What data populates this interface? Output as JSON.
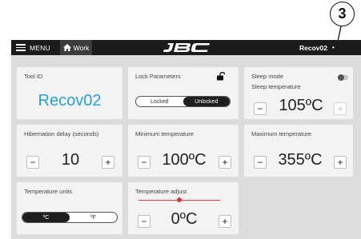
{
  "callout": {
    "number": "3"
  },
  "topbar": {
    "menu_label": "MENU",
    "work_label": "Work",
    "logo_text": "JBC",
    "device_name": "Recov02",
    "device_menu_glyph": "•"
  },
  "cards": {
    "tool_id": {
      "title": "Tool ID",
      "value": "Recov02"
    },
    "lock": {
      "title": "Lock Parameters",
      "options": [
        "Locked",
        "Unlocked"
      ],
      "selected": "Unlocked"
    },
    "sleep": {
      "title": "Sleep mode",
      "subtitle": "Sleep temperature",
      "value": "105ºC",
      "toggle_on": false
    },
    "hibernation": {
      "title": "Hibernation delay (seconds)",
      "value": "10"
    },
    "min_temp": {
      "title": "Minimum temperature",
      "value": "100ºC"
    },
    "max_temp": {
      "title": "Maximum temperature",
      "value": "355ºC"
    },
    "units": {
      "title": "Temperature units",
      "options": [
        "ºC",
        "ºF"
      ],
      "selected": "ºC"
    },
    "adjust": {
      "title": "Temperature adjust",
      "value": "0ºC",
      "slider_level": 0.5
    }
  },
  "stepper": {
    "minus": "−",
    "plus": "+"
  },
  "icons": {
    "menu": "hamburger-icon",
    "home": "home-icon",
    "lock": "unlock-icon",
    "toggle": "toggle-switch-icon"
  },
  "colors": {
    "accent_blue": "#29a0d8",
    "topbar_bg": "#1b1b1b",
    "slider_red": "#e23b3b",
    "panel_bg": "#dcdcdc",
    "card_bg": "#f3f3f3"
  }
}
